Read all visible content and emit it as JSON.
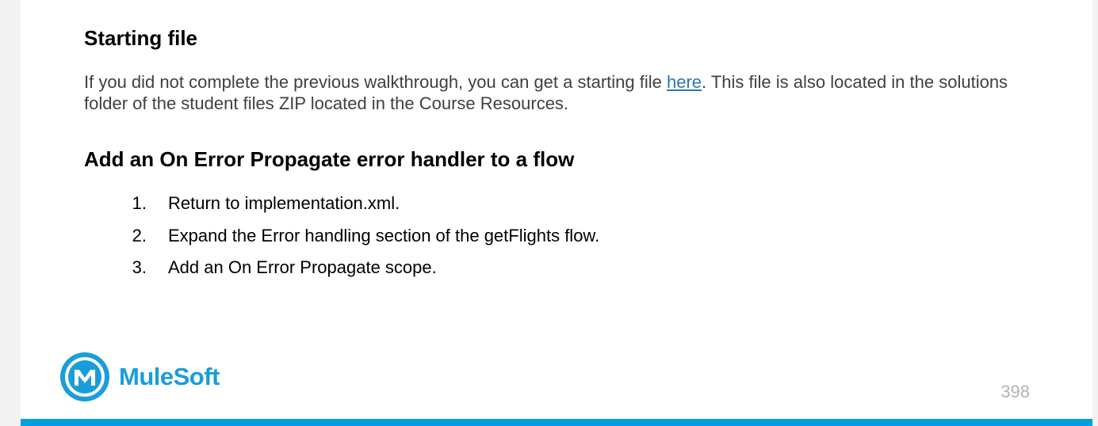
{
  "sections": {
    "starting_file": {
      "heading": "Starting file",
      "text_before_link": "If you did not complete the previous walkthrough, you can get a starting file ",
      "link_text": "here",
      "text_after_link": ". This file is also located in the solutions folder of the student files ZIP located in the Course Resources."
    },
    "add_handler": {
      "heading": "Add an On Error Propagate error handler to a flow",
      "steps": [
        {
          "num": "1.",
          "text": "Return to implementation.xml."
        },
        {
          "num": "2.",
          "text": "Expand the Error handling section of the getFlights flow."
        },
        {
          "num": "3.",
          "text": "Add an On Error Propagate scope."
        }
      ]
    }
  },
  "footer": {
    "logo_text": "MuleSoft",
    "logo_icon": "mulesoft-logo-icon",
    "page_number": "398"
  },
  "colors": {
    "brand": "#00a0df",
    "link": "#2e75b6",
    "body_text": "#404040"
  }
}
